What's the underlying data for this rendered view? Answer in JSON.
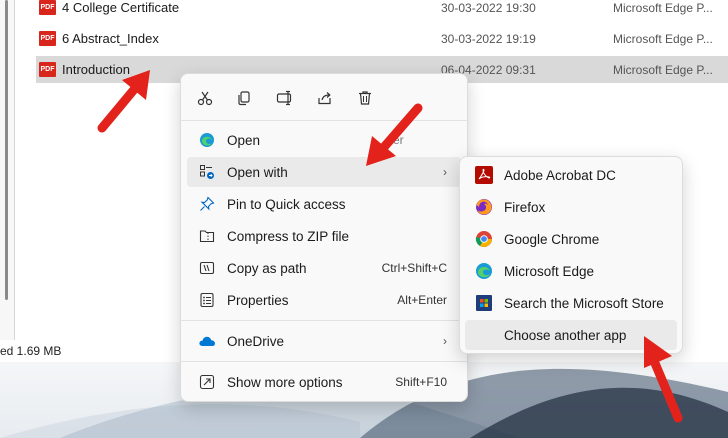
{
  "files": [
    {
      "name": "4 College Certificate",
      "date": "30-03-2022 19:30",
      "type": "Microsoft Edge P...",
      "badge": "PDF"
    },
    {
      "name": "6 Abstract_Index",
      "date": "30-03-2022 19:19",
      "type": "Microsoft Edge P...",
      "badge": "PDF"
    },
    {
      "name": "Introduction",
      "date": "06-04-2022 09:31",
      "type": "Microsoft Edge P...",
      "badge": "PDF"
    }
  ],
  "status": {
    "text": "ed  1.69 MB"
  },
  "context_menu": {
    "ghost_text": "er",
    "items": [
      {
        "label": "Open",
        "shortcut": "",
        "chevron": ""
      },
      {
        "label": "Open with",
        "shortcut": "",
        "chevron": "›"
      },
      {
        "label": "Pin to Quick access",
        "shortcut": "",
        "chevron": ""
      },
      {
        "label": "Compress to ZIP file",
        "shortcut": "",
        "chevron": ""
      },
      {
        "label": "Copy as path",
        "shortcut": "Ctrl+Shift+C",
        "chevron": ""
      },
      {
        "label": "Properties",
        "shortcut": "Alt+Enter",
        "chevron": ""
      },
      {
        "label": "OneDrive",
        "shortcut": "",
        "chevron": "›"
      },
      {
        "label": "Show more options",
        "shortcut": "Shift+F10",
        "chevron": ""
      }
    ]
  },
  "submenu": {
    "items": [
      {
        "label": "Adobe Acrobat DC"
      },
      {
        "label": "Firefox"
      },
      {
        "label": "Google Chrome"
      },
      {
        "label": "Microsoft Edge"
      },
      {
        "label": "Search the Microsoft Store"
      },
      {
        "label": "Choose another app"
      }
    ]
  },
  "colors": {
    "accent": "#0067c0",
    "arrow": "#e3221c",
    "pdf": "#d8261c",
    "selected": "#d9d9d9"
  }
}
